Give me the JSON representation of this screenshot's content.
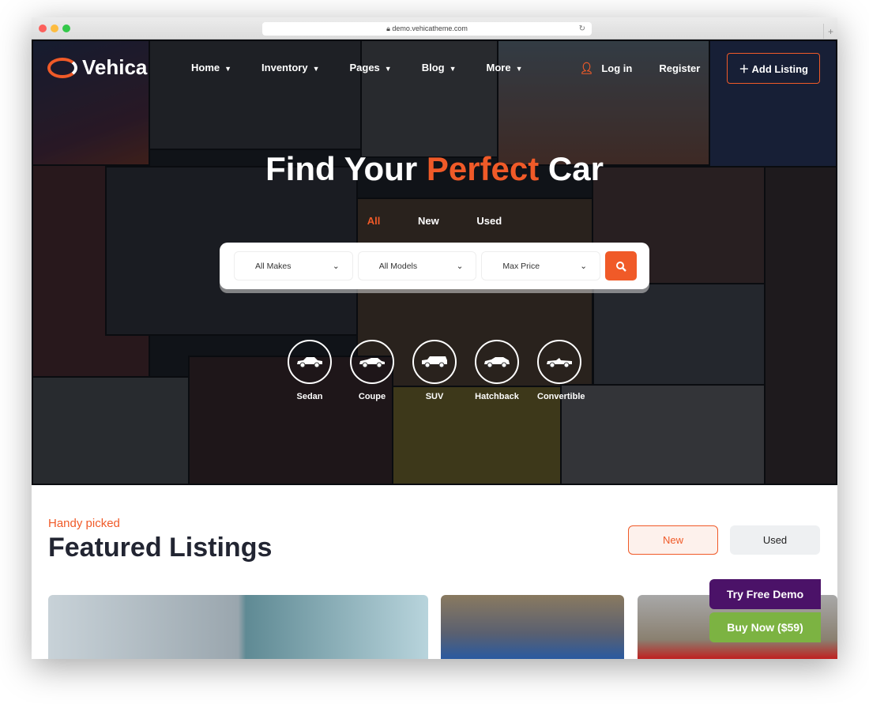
{
  "browser": {
    "url": "demo.vehicatheme.com"
  },
  "nav": {
    "logo": "Vehica",
    "menu": [
      {
        "label": "Home"
      },
      {
        "label": "Inventory"
      },
      {
        "label": "Pages"
      },
      {
        "label": "Blog"
      },
      {
        "label": "More"
      }
    ],
    "login": "Log in",
    "register": "Register",
    "add_listing": "Add Listing"
  },
  "hero": {
    "title_pre": "Find Your ",
    "title_accent": "Perfect",
    "title_post": " Car",
    "tabs": [
      "All",
      "New",
      "Used"
    ],
    "active_tab": "All",
    "filters": [
      {
        "label": "All Makes"
      },
      {
        "label": "All Models"
      },
      {
        "label": "Max Price"
      }
    ],
    "body_types": [
      {
        "label": "Sedan"
      },
      {
        "label": "Coupe"
      },
      {
        "label": "SUV"
      },
      {
        "label": "Hatchback"
      },
      {
        "label": "Convertible"
      }
    ]
  },
  "featured": {
    "eyebrow": "Handy picked",
    "title": "Featured Listings",
    "tabs": [
      "New",
      "Used"
    ],
    "active_tab": "New"
  },
  "promo": {
    "try_demo": "Try Free Demo",
    "buy_now": "Buy Now ($59)"
  },
  "colors": {
    "accent": "#f05a28",
    "demo_purple": "#4b1268",
    "buy_green": "#7cb342"
  }
}
